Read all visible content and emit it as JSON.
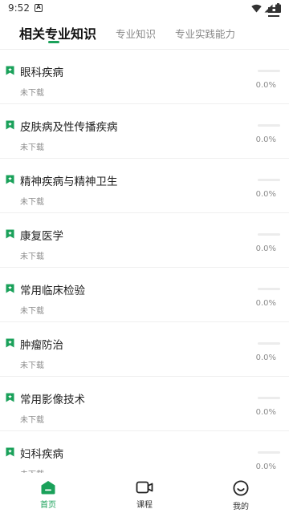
{
  "status_bar": {
    "time": "9:52",
    "notification_icon": "a-badge-icon",
    "icons": [
      "wifi-icon",
      "signal-icon",
      "battery-icon"
    ]
  },
  "tabs": [
    {
      "label": "相关专业知识",
      "active": true
    },
    {
      "label": "专业知识",
      "active": false
    },
    {
      "label": "专业实践能力",
      "active": false
    }
  ],
  "menu_icon": "menu-icon",
  "colors": {
    "accent": "#1aa15a",
    "divider": "#efefef",
    "muted": "#8c8c8c"
  },
  "list": {
    "items": [
      {
        "title": "眼科疾病",
        "status": "未下载",
        "progress": 0.0,
        "progress_label": "0.0%"
      },
      {
        "title": "皮肤病及性传播疾病",
        "status": "未下载",
        "progress": 0.0,
        "progress_label": "0.0%"
      },
      {
        "title": "精神疾病与精神卫生",
        "status": "未下载",
        "progress": 0.0,
        "progress_label": "0.0%"
      },
      {
        "title": "康复医学",
        "status": "未下载",
        "progress": 0.0,
        "progress_label": "0.0%"
      },
      {
        "title": "常用临床检验",
        "status": "未下载",
        "progress": 0.0,
        "progress_label": "0.0%"
      },
      {
        "title": "肿瘤防治",
        "status": "未下载",
        "progress": 0.0,
        "progress_label": "0.0%"
      },
      {
        "title": "常用影像技术",
        "status": "未下载",
        "progress": 0.0,
        "progress_label": "0.0%"
      },
      {
        "title": "妇科疾病",
        "status": "未下载",
        "progress": 0.0,
        "progress_label": "0.0%"
      }
    ]
  },
  "bottom_nav": [
    {
      "label": "首页",
      "icon": "home-icon",
      "active": true
    },
    {
      "label": "课程",
      "icon": "video-camera-icon",
      "active": false
    },
    {
      "label": "我的",
      "icon": "smiley-face-icon",
      "active": false
    }
  ]
}
